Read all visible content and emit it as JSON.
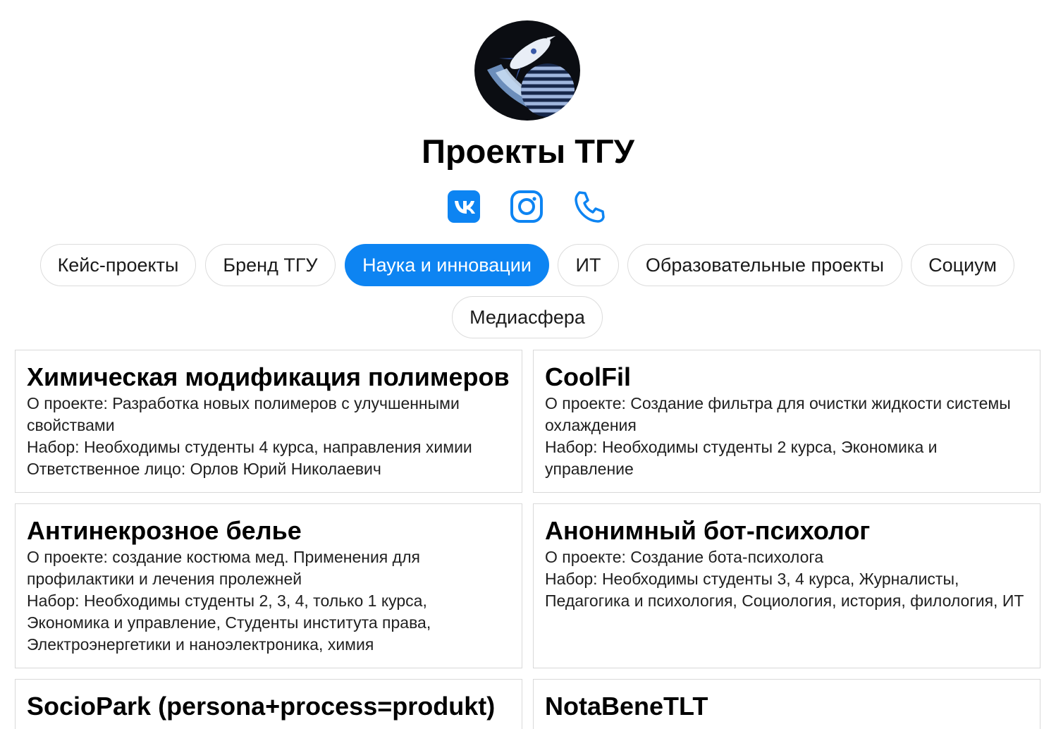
{
  "header": {
    "title": "Проекты ТГУ"
  },
  "social_icons": [
    "vk-icon",
    "instagram-icon",
    "phone-icon"
  ],
  "colors": {
    "accent": "#0d84f2",
    "border": "#d9d9d9"
  },
  "categories": [
    {
      "label": "Кейс-проекты",
      "active": false
    },
    {
      "label": "Бренд ТГУ",
      "active": false
    },
    {
      "label": "Наука и инновации",
      "active": true
    },
    {
      "label": "ИТ",
      "active": false
    },
    {
      "label": "Образовательные проекты",
      "active": false
    },
    {
      "label": "Социум",
      "active": false
    },
    {
      "label": "Медиасфера",
      "active": false
    }
  ],
  "projects": [
    {
      "title": "Химическая модификация полимеров",
      "about": "О проекте: Разработка новых полимеров с улучшенными свойствами",
      "recruit": "Набор: Необходимы студенты 4 курса, направления химии",
      "responsible": "Ответственное лицо: Орлов Юрий Николаевич"
    },
    {
      "title": "CoolFil",
      "about": "О проекте: Создание фильтра для очистки жидкости системы охлаждения",
      "recruit": "Набор: Необходимы студенты 2 курса, Экономика и управление"
    },
    {
      "title": "Антинекрозное белье",
      "about": "О проекте: создание костюма мед. Применения для профилактики и лечения пролежней",
      "recruit": "Набор: Необходимы студенты 2, 3, 4, только 1 курса, Экономика и управление, Студенты института права, Электроэнергетики и наноэлектроника, химия"
    },
    {
      "title": "Анонимный бот-психолог",
      "about": "О проекте: Создание бота-психолога",
      "recruit": "Набор: Необходимы студенты 3, 4 курса, Журналисты, Педагогика и психология, Социология, история, филология, ИТ"
    },
    {
      "title": "SocioPark (persona+process=produkt)"
    },
    {
      "title": "NotaBeneTLT"
    }
  ]
}
